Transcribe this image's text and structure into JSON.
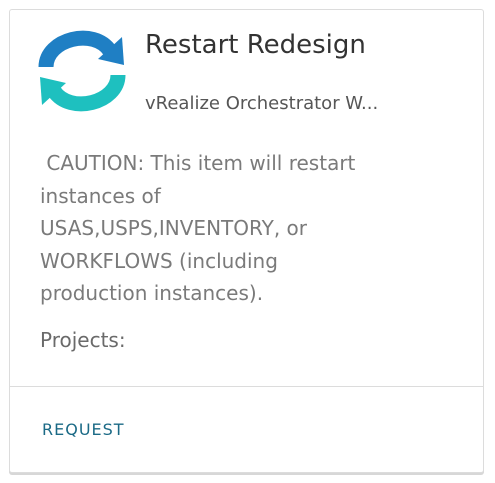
{
  "card": {
    "title": "Restart Redesign",
    "subtitle": "vRealize Orchestrator W...",
    "description": " CAUTION: This item will restart\ninstances of\nUSAS,USPS,INVENTORY, or\nWORKFLOWS (including\nproduction instances).",
    "projects_label": "Projects:",
    "request_label": "REQUEST",
    "icon": "refresh-icon"
  },
  "colors": {
    "icon_blue": "#1f7fc4",
    "icon_teal": "#1ec0bf",
    "request_link": "#1b6a86",
    "title_text": "#333333",
    "body_text": "#7a7a7a"
  }
}
